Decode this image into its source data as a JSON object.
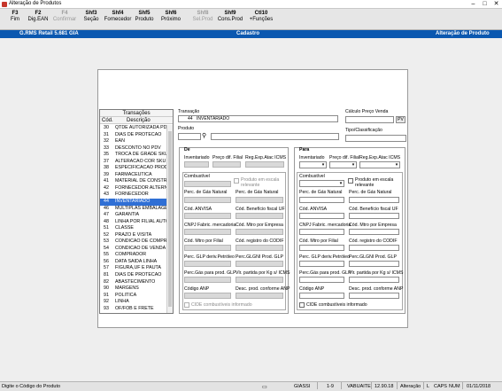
{
  "window": {
    "title": "Alteração de Produtos",
    "minimize": "–",
    "maximize": "□",
    "close": "✕"
  },
  "toolbar": {
    "keys": [
      {
        "key": "F3",
        "label": "Fim",
        "enabled": true
      },
      {
        "key": "F2",
        "label": "Dig.EAN",
        "enabled": true
      },
      {
        "key": "F4",
        "label": "Confirmar",
        "enabled": false
      },
      {
        "key": "Shf3",
        "label": "Seção",
        "enabled": true
      },
      {
        "key": "Shf4",
        "label": "Fornecedor",
        "enabled": true
      },
      {
        "key": "Shf5",
        "label": "Produto",
        "enabled": true
      },
      {
        "key": "Shf6",
        "label": "Próximo",
        "enabled": true
      },
      {
        "key": "Shf8",
        "label": "Sel.Prod",
        "enabled": false
      },
      {
        "key": "Shf9",
        "label": "Cons.Prod",
        "enabled": true
      },
      {
        "key": "Ctl10",
        "label": "+Funções",
        "enabled": true
      }
    ]
  },
  "statusline": {
    "system": "G.RMS Retail 5.681 GIA",
    "mode": "Cadastro",
    "operation": "Alteração de Produto"
  },
  "transacoes": {
    "title": "Transações",
    "col_code": "Cód.",
    "col_desc": "Descrição",
    "selected_code": "44",
    "rows": [
      {
        "code": "30",
        "desc": "QTDE AUTORIZADA PDV"
      },
      {
        "code": "31",
        "desc": "DIAS DE PROTECAO"
      },
      {
        "code": "32",
        "desc": "EAN"
      },
      {
        "code": "33",
        "desc": "DESCONTO NO PDV"
      },
      {
        "code": "35",
        "desc": "TROCA DE GRADE SKU"
      },
      {
        "code": "37",
        "desc": "ALTERACAO COR SKU"
      },
      {
        "code": "38",
        "desc": "ESPECIFICACAO PRODUTO"
      },
      {
        "code": "39",
        "desc": "FARMACEUTICA"
      },
      {
        "code": "41",
        "desc": "MATERIAL DE CONSTRUCAO"
      },
      {
        "code": "42",
        "desc": "FORNECEDOR ALTERNATIVO"
      },
      {
        "code": "43",
        "desc": "FORNECEDOR"
      },
      {
        "code": "44",
        "desc": "INVENTARIADO"
      },
      {
        "code": "46",
        "desc": "MULTIPLAS EMBALAGENS"
      },
      {
        "code": "47",
        "desc": "GARANTIA"
      },
      {
        "code": "48",
        "desc": "LINHA POR FILIAL AUTO"
      },
      {
        "code": "51",
        "desc": "CLASSE"
      },
      {
        "code": "52",
        "desc": "PRAZO E VISITA"
      },
      {
        "code": "53",
        "desc": "CONDICAO DE COMPRA"
      },
      {
        "code": "54",
        "desc": "CONDICAO DE VENDA"
      },
      {
        "code": "55",
        "desc": "COMPRADOR"
      },
      {
        "code": "56",
        "desc": "DATA SAIDA LINHA"
      },
      {
        "code": "57",
        "desc": "FIGURA,UF E PAUTA"
      },
      {
        "code": "81",
        "desc": "DIAS DE PROTECAO"
      },
      {
        "code": "82",
        "desc": "ABASTECIMENTO"
      },
      {
        "code": "90",
        "desc": "MARGENS"
      },
      {
        "code": "91",
        "desc": "POLITICA"
      },
      {
        "code": "92",
        "desc": "LINHA"
      },
      {
        "code": "93",
        "desc": "OF/FOB E FRETE"
      }
    ]
  },
  "transacao": {
    "label": "Transação",
    "code": "44",
    "desc": "INVENTARIADO"
  },
  "produto": {
    "label": "Produto"
  },
  "calculo": {
    "label": "Cálculo Preço Venda",
    "button": "PV"
  },
  "tipo": {
    "label": "Tipo/Classificação"
  },
  "de": {
    "title": "De",
    "inventariado": "Inventariado",
    "preco_filial": "Preço dif. Filial",
    "reg_exp": "Reg.Exp.Atac ICMS",
    "combustivel": "Combustível",
    "produto_escala": "Produto em escala relevante",
    "perc_gas": "Perc. de Gás Natural",
    "cod_anvisa": "Cód. ANVISA",
    "cod_beneficio": "Cód. Benefício fiscal UF",
    "cnpj_fabric": "CNPJ Fabric. mercadoria",
    "cod_mtro_empresa": "Cód. Mtro por Empresa",
    "cod_mtro_filial": "Cód. Mtro por Filial",
    "cod_registro": "Cód. registro do CODIF",
    "perc_glp": "Perc. GLP deriv.Petróleo",
    "perc_glgni": "Perc.GLGNI Prod. GLP",
    "perc_gas_glp": "Perc.Gás para prod. GLP",
    "vlr_partida": "Vlr. partida por Kg s/ ICMS",
    "codigo_anp": "Código ANP",
    "desc_prod": "Desc. prod. conforme ANP",
    "cide": "CIDE combustíveis informado"
  },
  "para": {
    "title": "Para",
    "inventariado": "Inventariado",
    "preco_filial": "Preço dif. Filial",
    "reg_exp": "Reg.Exp.Atac ICMS",
    "combustivel": "Combustível",
    "produto_escala": "Produto em escala relevante",
    "perc_gas": "Perc. de Gás Natural",
    "cod_anvisa": "Cód. ANVISA",
    "cod_beneficio": "Cód. Benefício fiscal UF",
    "cnpj_fabric": "CNPJ Fabric. mercadoria",
    "cod_mtro_empresa": "Cód. Mtro por Empresa",
    "cod_mtro_filial": "Cód. Mtro por Filial",
    "cod_registro": "Cód. registro do CODIF",
    "perc_glp": "Perc. GLP deriv.Petróleo",
    "perc_glgni": "Perc.GLGNI Prod. GLP",
    "perc_gas_glp": "Perc.Gás para prod. GLP",
    "vlr_partida": "Vlr. partida por Kg s/ ICMS",
    "codigo_anp": "Código ANP",
    "desc_prod": "Desc. prod. conforme ANP",
    "cide": "CIDE combustíveis informado"
  },
  "bottombar": {
    "hint": "Digite o Código do Produto",
    "user": "GIASSI",
    "store": "1-9",
    "company": "VABUAITE",
    "version": "12.90.18",
    "mode": "Alteração",
    "l": "L",
    "caps": "CAPS",
    "num": "NUM",
    "date": "01/11/2018"
  }
}
